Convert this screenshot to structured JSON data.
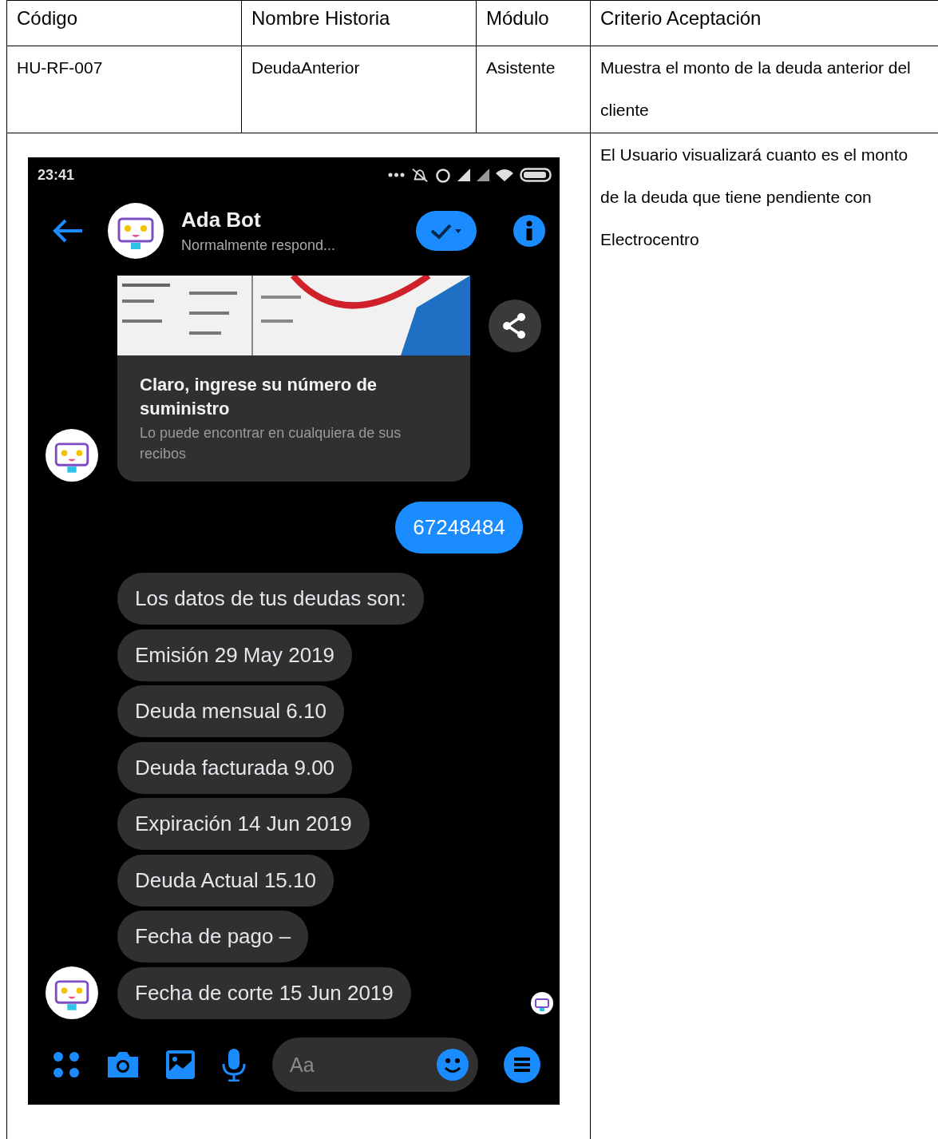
{
  "table": {
    "columns": [
      "Código",
      "Nombre Historia",
      "Módulo",
      "Criterio Aceptación"
    ],
    "row": [
      "HU-RF-007",
      "DeudaAnterior",
      "Asistente",
      "Muestra el monto de la deuda anterior del cliente"
    ],
    "description": "El Usuario visualizará cuanto es el monto de la deuda que tiene pendiente con Electrocentro"
  },
  "phone": {
    "status_time": "23:41",
    "contact": {
      "name": "Ada Bot",
      "status": "Normalmente respond..."
    },
    "card": {
      "title": "Claro, ingrese su número de suministro",
      "subtitle": "Lo puede encontrar en cualquiera de sus recibos"
    },
    "messages": [
      {
        "kind": "sent",
        "text": "67248484"
      },
      {
        "kind": "received",
        "text": "Los datos de tus deudas son:"
      },
      {
        "kind": "received",
        "text": "Emisión 29 May 2019"
      },
      {
        "kind": "received",
        "text": "Deuda mensual 6.10"
      },
      {
        "kind": "received",
        "text": "Deuda facturada 9.00"
      },
      {
        "kind": "received",
        "text": "Expiración 14 Jun 2019"
      },
      {
        "kind": "received",
        "text": "Deuda Actual 15.10"
      },
      {
        "kind": "received",
        "text": "Fecha de pago –"
      },
      {
        "kind": "received",
        "text": "Fecha de corte 15 Jun 2019"
      }
    ],
    "composer": {
      "placeholder": "Aa"
    }
  }
}
